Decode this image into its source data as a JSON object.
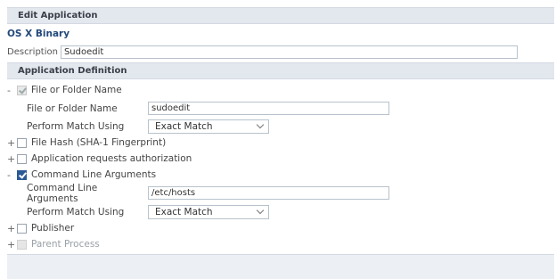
{
  "header": {
    "title": "Edit Application"
  },
  "app": {
    "subtitle": "OS X Binary",
    "description_label": "Description",
    "description_value": "Sudoedit"
  },
  "definition": {
    "title": "Application Definition",
    "folder": {
      "toggle": "-",
      "label": "File or Folder Name",
      "checked": true,
      "field_label": "File or Folder Name",
      "field_value": "sudoedit",
      "match_label": "Perform Match Using",
      "match_value": "Exact Match"
    },
    "hash": {
      "toggle": "+",
      "label": "File Hash (SHA-1 Fingerprint)",
      "checked": false
    },
    "auth": {
      "toggle": "+",
      "label": "Application requests authorization",
      "checked": false
    },
    "cmdline": {
      "toggle": "-",
      "label": "Command Line Arguments",
      "checked": true,
      "field_label": "Command Line Arguments",
      "field_value": "/etc/hosts",
      "match_label": "Perform Match Using",
      "match_value": "Exact Match"
    },
    "publisher": {
      "toggle": "+",
      "label": "Publisher",
      "checked": false
    },
    "parent": {
      "toggle": "+",
      "label": "Parent Process",
      "checked": false,
      "disabled": true
    }
  }
}
